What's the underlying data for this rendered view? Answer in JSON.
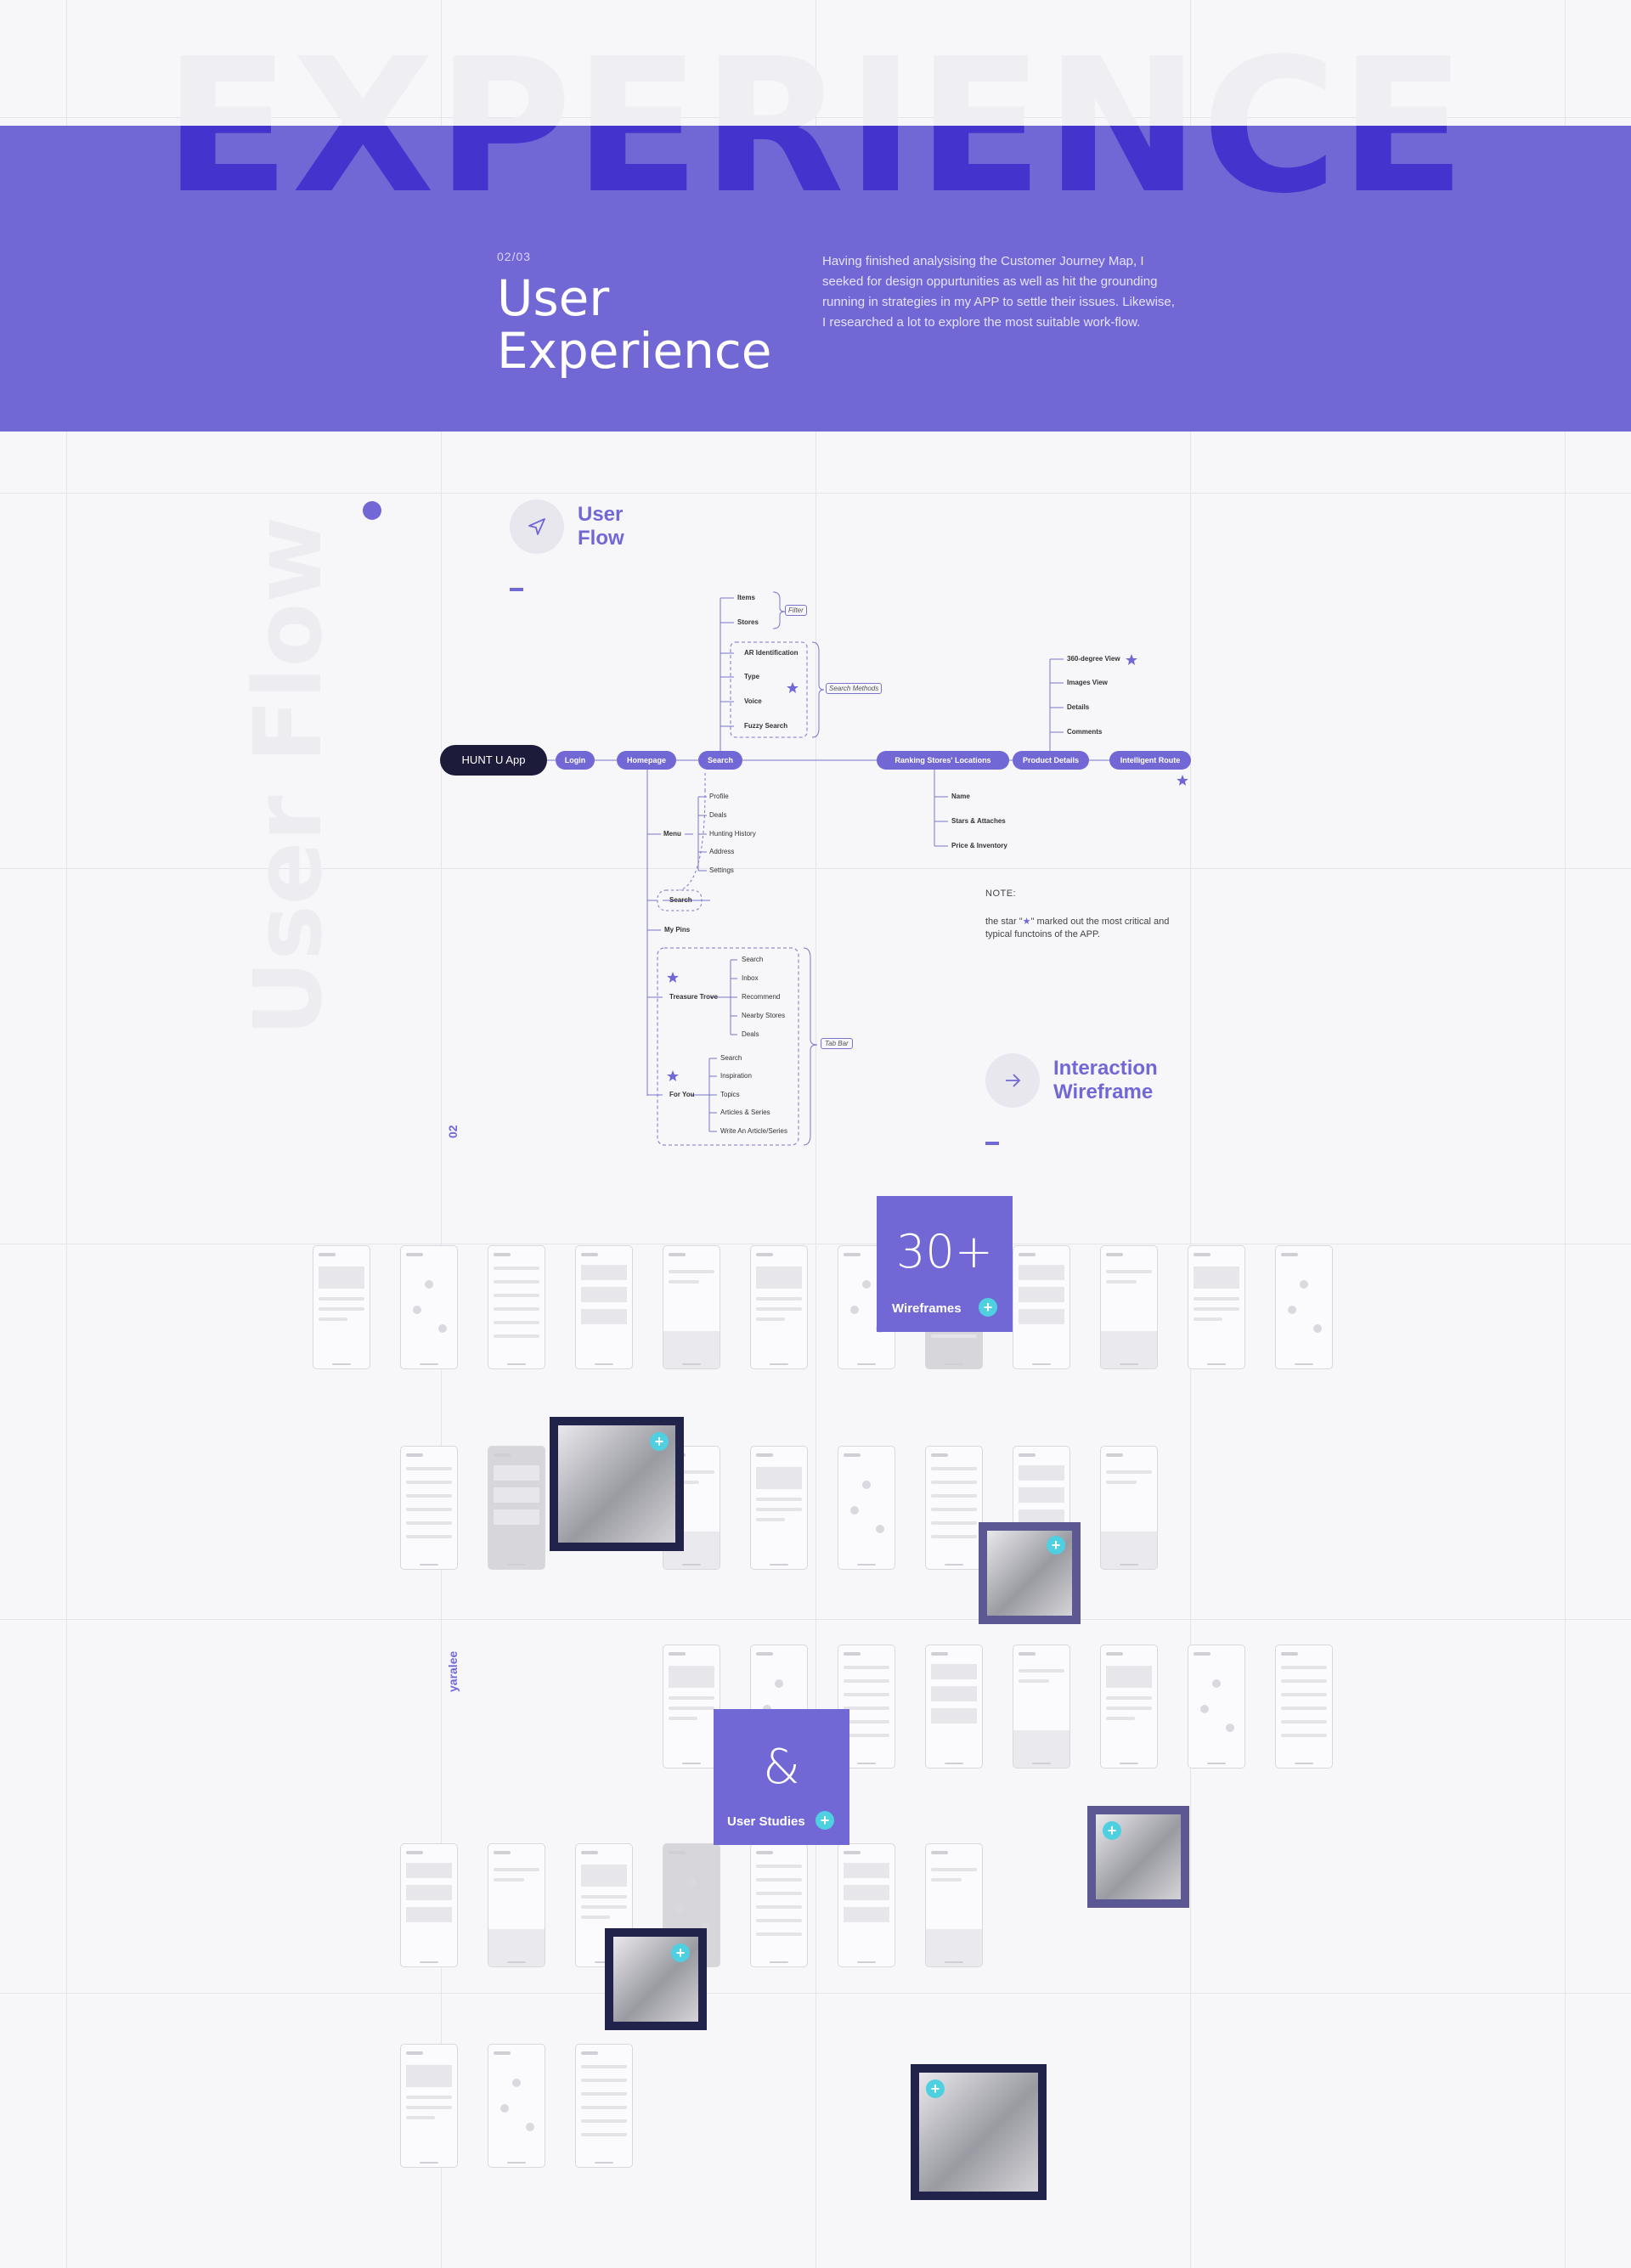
{
  "hero": {
    "big_word": "EXPERIENCE",
    "kicker": "02/03",
    "title_line1": "User",
    "title_line2": "Experience",
    "intro": "Having finished analysising the Customer Journey Map, I seeked for design oppurtunities as well as hit the grounding running in strategies in my APP to settle their issues. Likewise, I researched a lot to explore the most suitable work-flow."
  },
  "userflow_section": {
    "vertical_word": "User Flow",
    "heading_line1": "User",
    "heading_line2": "Flow",
    "side_number": "02"
  },
  "flow": {
    "main": [
      "HUNT U App",
      "Login",
      "Homepage",
      "Search",
      "Ranking Stores' Locations",
      "Product Details",
      "Intelligent Route"
    ],
    "search_top": [
      "Items",
      "Stores"
    ],
    "search_methods": [
      "AR Identification",
      "Type",
      "Voice",
      "Fuzzy Search"
    ],
    "filter_label": "Filter",
    "search_methods_label": "Search Methods",
    "details_children": [
      "360-degree View",
      "Images View",
      "Details",
      "Comments"
    ],
    "ranking_children": [
      "Name",
      "Stars & Attaches",
      "Price & Inventory"
    ],
    "menu_label": "Menu",
    "menu_children": [
      "Profile",
      "Deals",
      "Hunting History",
      "Address",
      "Settings"
    ],
    "home_search": "Search",
    "my_pins": "My Pins",
    "treasure_trove": "Treasure Trove",
    "treasure_children": [
      "Search",
      "Inbox",
      "Recommend",
      "Nearby Stores",
      "Deals"
    ],
    "for_you": "For You",
    "foryou_children": [
      "Search",
      "Inspiration",
      "Topics",
      "Articles & Series",
      "Write An Article/Series"
    ],
    "tab_bar_label": "Tab Bar"
  },
  "note": {
    "heading": "NOTE:",
    "text_before": "the star \"",
    "text_after": "\" marked out the most critical and typical functoins of the APP."
  },
  "wireframe_section": {
    "heading_line1": "Interaction",
    "heading_line2": "Wireframe",
    "side_label": "yaralee"
  },
  "cards": {
    "wireframes_big": "30+",
    "wireframes_label": "Wireframes",
    "studies_big": "&",
    "studies_label": "User Studies",
    "plus": "+"
  },
  "colors": {
    "accent": "#7168d6",
    "deep": "#4433cc",
    "navy": "#22234a",
    "cyan": "#4fd0e0",
    "background": "#f7f7fa"
  }
}
